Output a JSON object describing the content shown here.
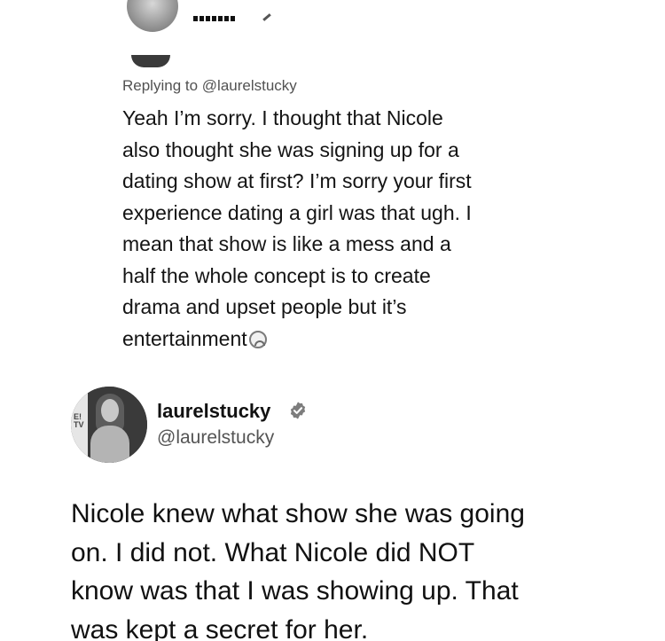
{
  "top_reply": {
    "replying_prefix": "Replying to",
    "replying_handle": "@laurelstucky",
    "lines": [
      "Yeah I’m sorry. I thought that Nicole",
      "also thought she was signing up for a",
      "dating show at first? I’m sorry your first",
      "experience dating a girl was that ugh. I",
      "mean that show is like a mess and a",
      "half the whole concept is to create",
      "drama and upset people but it’s",
      "entertainment"
    ],
    "end_icon": "upside-down-face-emoji-icon"
  },
  "tweet": {
    "author_name": "laurelstucky",
    "author_handle": "@laurelstucky",
    "verified_icon": "verified-badge-icon",
    "lines": [
      "Nicole knew what show she was going",
      "on. I did not. What Nicole did NOT",
      "know was that I was showing up. That",
      "was kept a secret for her."
    ]
  }
}
